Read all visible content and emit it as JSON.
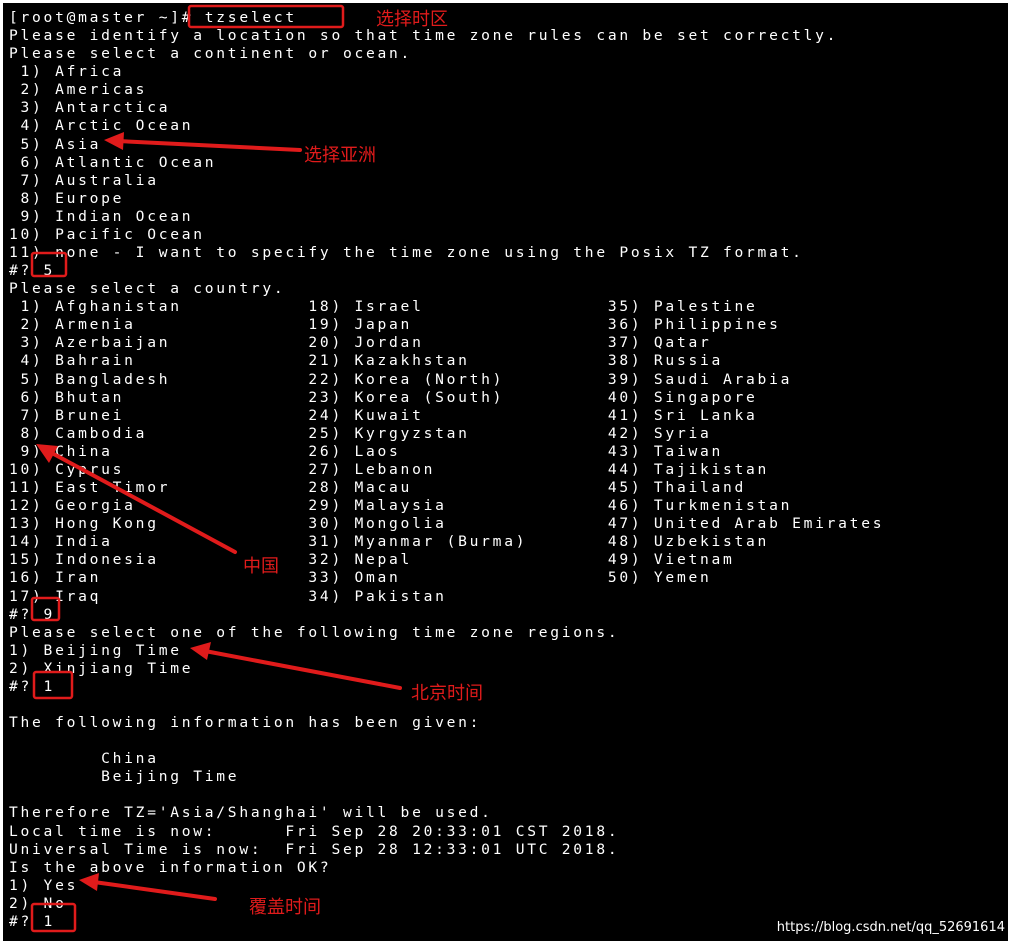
{
  "terminal": {
    "prompt": "[root@master ~]#",
    "lines": [
      "[root@master ~]# tzselect",
      "Please identify a location so that time zone rules can be set correctly.",
      "Please select a continent or ocean.",
      " 1) Africa",
      " 2) Americas",
      " 3) Antarctica",
      " 4) Arctic Ocean",
      " 5) Asia",
      " 6) Atlantic Ocean",
      " 7) Australia",
      " 8) Europe",
      " 9) Indian Ocean",
      "10) Pacific Ocean",
      "11) none - I want to specify the time zone using the Posix TZ format.",
      "#? 5",
      "Please select a country.",
      " 1) Afghanistan           18) Israel                35) Palestine",
      " 2) Armenia               19) Japan                 36) Philippines",
      " 3) Azerbaijan            20) Jordan                37) Qatar",
      " 4) Bahrain               21) Kazakhstan            38) Russia",
      " 5) Bangladesh            22) Korea (North)         39) Saudi Arabia",
      " 6) Bhutan                23) Korea (South)         40) Singapore",
      " 7) Brunei                24) Kuwait                41) Sri Lanka",
      " 8) Cambodia              25) Kyrgyzstan            42) Syria",
      " 9) China                 26) Laos                  43) Taiwan",
      "10) Cyprus                27) Lebanon               44) Tajikistan",
      "11) East Timor            28) Macau                 45) Thailand",
      "12) Georgia               29) Malaysia              46) Turkmenistan",
      "13) Hong Kong             30) Mongolia              47) United Arab Emirates",
      "14) India                 31) Myanmar (Burma)       48) Uzbekistan",
      "15) Indonesia             32) Nepal                 49) Vietnam",
      "16) Iran                  33) Oman                  50) Yemen",
      "17) Iraq                  34) Pakistan",
      "#? 9",
      "Please select one of the following time zone regions.",
      "1) Beijing Time",
      "2) Xinjiang Time",
      "#? 1",
      "",
      "The following information has been given:",
      "",
      "        China",
      "        Beijing Time",
      "",
      "Therefore TZ='Asia/Shanghai' will be used.",
      "Local time is now:      Fri Sep 28 20:33:01 CST 2018.",
      "Universal Time is now:  Fri Sep 28 12:33:01 UTC 2018.",
      "Is the above information OK?",
      "1) Yes",
      "2) No",
      "#? 1"
    ]
  },
  "annotations": {
    "select_timezone": "选择时区",
    "select_asia": "选择亚洲",
    "china": "中国",
    "beijing_time": "北京时间",
    "overwrite_time": "覆盖时间",
    "color": "#e01b1b"
  },
  "watermark": "https://blog.csdn.net/qq_52691614"
}
